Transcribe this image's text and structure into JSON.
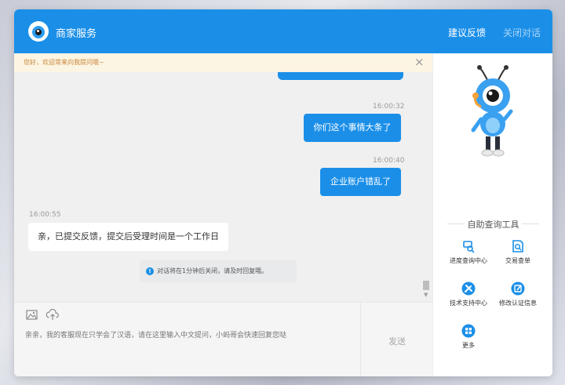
{
  "header": {
    "title": "商家服务",
    "feedback_label": "建议反馈",
    "close_label": "关闭对话"
  },
  "notice": {
    "text": "您好，欢迎常来向我提问哦~",
    "close_glyph": "×"
  },
  "messages": [
    {
      "time": "16:00:32",
      "text": "你们这个事情大条了",
      "side": "out"
    },
    {
      "time": "16:00:40",
      "text": "企业账户错乱了",
      "side": "out"
    },
    {
      "time": "16:00:55",
      "text": "亲，已提交反馈，提交后受理时间是一个工作日",
      "side": "in"
    }
  ],
  "system_message": {
    "icon": "!",
    "text": "对话将在1分钟后关闭，请及时回复哦。"
  },
  "input": {
    "placeholder": "亲亲，我的客服现在只学会了汉语，请在这里输入中文提问，小蚂哥会快速回复您哒",
    "send_label": "发送",
    "icons": [
      "image-icon",
      "upload-icon"
    ]
  },
  "tools_panel": {
    "title": "自助查询工具",
    "tools": [
      {
        "label": "进度查询中心",
        "icon": "progress-search-icon",
        "color": "#1b8fe8"
      },
      {
        "label": "交易查单",
        "icon": "transaction-query-icon",
        "color": "#1b8fe8"
      },
      {
        "label": "技术支持中心",
        "icon": "tools-icon",
        "color": "#1b8fe8"
      },
      {
        "label": "修改认证信息",
        "icon": "edit-icon",
        "color": "#1b8fe8"
      },
      {
        "label": "更多",
        "icon": "more-icon",
        "color": "#1b8fe8"
      }
    ]
  },
  "colors": {
    "brand": "#1b8fe8",
    "notice_bg": "#fdf5e3",
    "chat_bg": "#f0f0f0"
  }
}
